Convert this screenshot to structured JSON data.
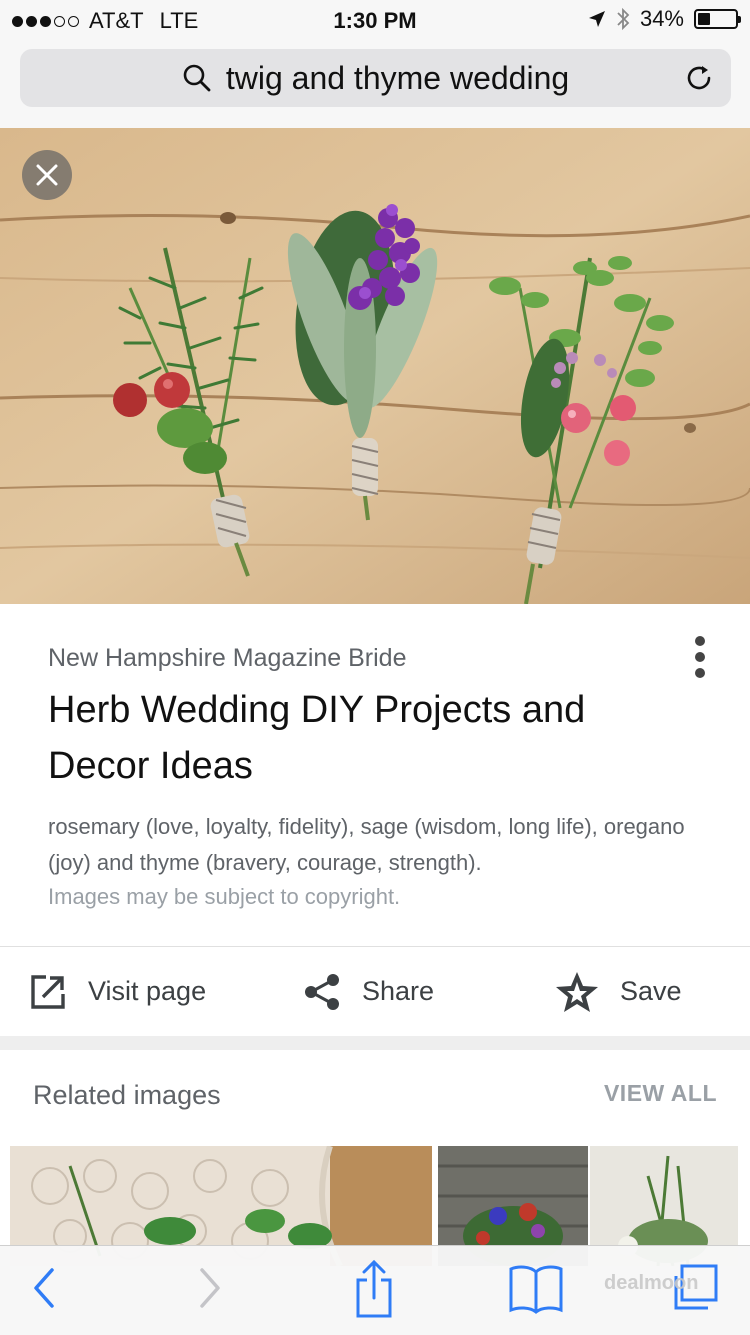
{
  "status_bar": {
    "carrier": "AT&T",
    "network": "LTE",
    "time": "1:30 PM",
    "battery": "34%",
    "battery_level": 0.34,
    "signal_bars_filled": 3,
    "signal_bars_total": 5
  },
  "address_bar": {
    "query": "twig and thyme wedding",
    "icons": [
      "search-icon",
      "reload-icon"
    ]
  },
  "hero_image": {
    "subject": "three herb boutonnieres on wooden planks",
    "close_icon": "close-icon"
  },
  "result": {
    "source": "New Hampshire Magazine Bride",
    "title": "Herb Wedding DIY Projects and Decor Ideas",
    "description": "rosemary (love, loyalty, fidelity), sage (wisdom, long life), oregano (joy) and thyme (bravery, courage, strength).",
    "copyright": "Images may be subject to copyright.",
    "actions": [
      {
        "label": "Visit page",
        "icon": "open-external-icon"
      },
      {
        "label": "Share",
        "icon": "share-icon"
      },
      {
        "label": "Save",
        "icon": "star-icon"
      }
    ]
  },
  "related": {
    "title": "Related images",
    "view_all": "VIEW ALL"
  },
  "toolbar": {
    "icons": [
      "back-icon",
      "forward-icon",
      "share-icon",
      "bookmarks-icon",
      "tabs-icon"
    ]
  },
  "watermark": "dealmoon",
  "colors": {
    "toolbar_accent": "#2f7cf6",
    "disabled": "#c4c4c8",
    "wood": "#d8b98e"
  }
}
